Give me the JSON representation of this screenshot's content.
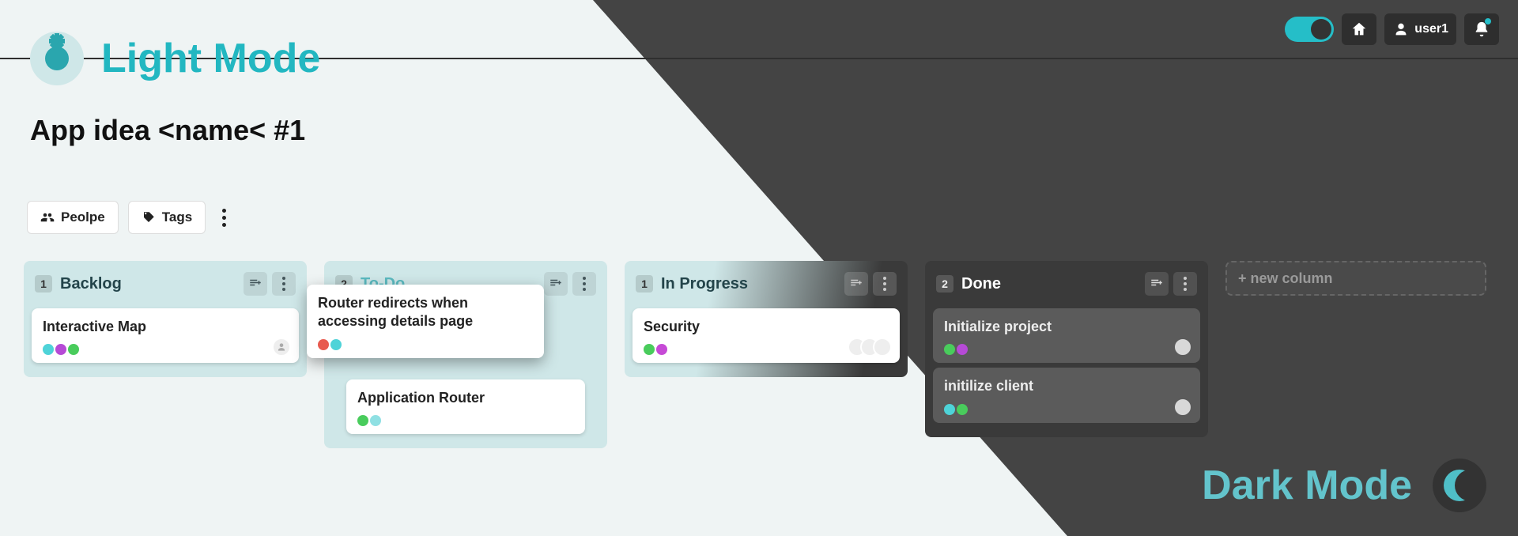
{
  "theme": {
    "light_label": "Light Mode",
    "dark_label": "Dark Mode",
    "accent": "#25bec8"
  },
  "header": {
    "username": "user1"
  },
  "board": {
    "title": "App idea <name< #1",
    "filters": {
      "people_label": "Peolpe",
      "tags_label": "Tags"
    },
    "new_column_label": "+ new column",
    "columns": [
      {
        "id": "backlog",
        "title": "Backlog",
        "count": "1",
        "theme": "light",
        "cards": [
          {
            "title": "Interactive Map",
            "tag_colors": [
              "#4ed3d8",
              "#b64ad6",
              "#49cc5c"
            ],
            "assignees": 1
          }
        ]
      },
      {
        "id": "todo",
        "title": "To-Do",
        "count": "2",
        "theme": "mid",
        "floating_card": {
          "title": "Router redirects when accessing details page",
          "tag_colors": [
            "#e85a4f",
            "#4ed3d8"
          ]
        },
        "cards": [
          {
            "title": "Application Router",
            "tag_colors": [
              "#49cc5c",
              "#8fe0e3"
            ],
            "assignees": 0
          }
        ]
      },
      {
        "id": "inprogress",
        "title": "In Progress",
        "count": "1",
        "theme": "inprog",
        "cards": [
          {
            "title": "Security",
            "tag_colors": [
              "#49cc5c",
              "#c64ad6"
            ],
            "assignees": 3
          }
        ]
      },
      {
        "id": "done",
        "title": "Done",
        "count": "2",
        "theme": "dark",
        "cards": [
          {
            "title": "Initialize project",
            "tag_colors": [
              "#49cc5c",
              "#b64ad6"
            ],
            "assignees": 1
          },
          {
            "title": "initilize client",
            "tag_colors": [
              "#4ed3d8",
              "#49cc5c"
            ],
            "assignees": 1
          }
        ]
      }
    ]
  }
}
